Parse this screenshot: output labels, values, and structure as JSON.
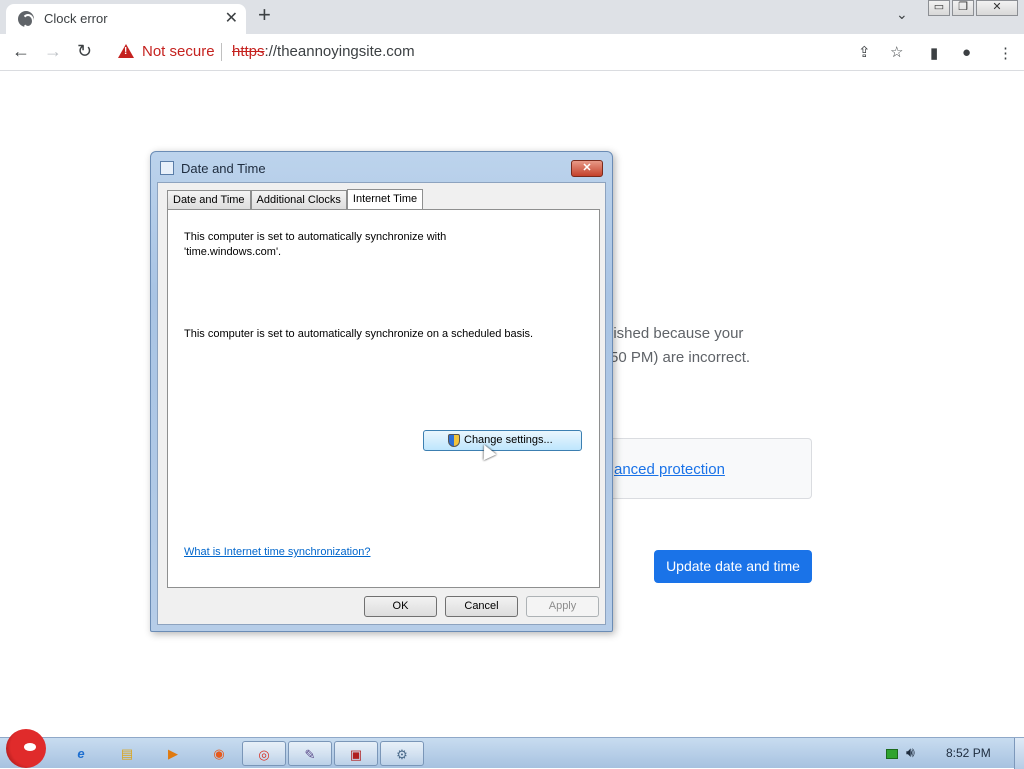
{
  "browser": {
    "tab": {
      "title": "Clock error",
      "close": "✕"
    },
    "new_tab": "+",
    "tab_list": "⌄",
    "window_buttons": {
      "minimize": "▭",
      "restore": "❐",
      "close": "✕"
    },
    "nav": {
      "back": "←",
      "forward": "→",
      "reload": "↻"
    },
    "omnibox": {
      "security_label": "Not secure",
      "url_scheme": "https",
      "url_rest": "://theannoyingsite.com"
    },
    "toolbar_icons": {
      "share": "⇪",
      "bookmark": "☆",
      "side_panel": "▮",
      "profile": "●",
      "menu": "⋮"
    }
  },
  "page": {
    "message_line1": "lished because your",
    "message_line2": "50 PM) are incorrect.",
    "advanced_link": "anced protection",
    "update_button": "Update date and time"
  },
  "dialog": {
    "title": "Date and Time",
    "close": "✕",
    "tabs": [
      {
        "label": "Date and Time"
      },
      {
        "label": "Additional Clocks"
      },
      {
        "label": "Internet Time"
      }
    ],
    "active_tab": "Internet Time",
    "sync_text_line1": "This computer is set to automatically synchronize with",
    "sync_text_line2": "'time.windows.com'.",
    "schedule_text": "This computer is set to automatically synchronize on a scheduled basis.",
    "change_settings_button": "Change settings...",
    "help_link": "What is Internet time synchronization?",
    "buttons": {
      "ok": "OK",
      "cancel": "Cancel",
      "apply": "Apply"
    }
  },
  "taskbar": {
    "apps": [
      {
        "icon": "internet-explorer-icon",
        "glyph": "e"
      },
      {
        "icon": "folder-icon",
        "glyph": "▤"
      },
      {
        "icon": "media-player-icon",
        "glyph": "▶"
      },
      {
        "icon": "firefox-icon",
        "glyph": "◉"
      },
      {
        "icon": "chrome-icon",
        "glyph": "◎"
      },
      {
        "icon": "app-icon",
        "glyph": "✎"
      },
      {
        "icon": "app-icon-red",
        "glyph": "▣"
      },
      {
        "icon": "date-time-icon",
        "glyph": "⚙"
      }
    ],
    "clock": "8:52 PM"
  },
  "colors": {
    "accent_blue": "#1a73e8",
    "not_secure_red": "#c5221f",
    "dialog_frame": "#a9c4e4"
  }
}
